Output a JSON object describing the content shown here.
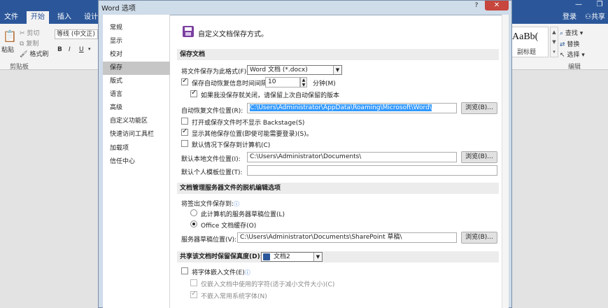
{
  "ribbon": {
    "tabs": [
      "文件",
      "开始",
      "插入",
      "设计"
    ],
    "login": "登录",
    "share": "共享",
    "paste": "粘贴",
    "cut": "剪切",
    "copy": "复制",
    "format_painter": "格式刷",
    "clipboard_label": "剪贴板",
    "font_name": "等线 (中文正)",
    "bold": "B",
    "italic": "I",
    "underline": "U",
    "styles_sample": "AaBb(",
    "styles_sample_label": "副标题",
    "find": "查找",
    "replace": "替换",
    "select": "选择",
    "editing_label": "编辑"
  },
  "dialog": {
    "title": "Word 选项",
    "help": "?",
    "close": "✕",
    "nav": [
      {
        "label": "常规"
      },
      {
        "label": "显示"
      },
      {
        "label": "校对"
      },
      {
        "label": "保存",
        "active": true
      },
      {
        "label": "版式"
      },
      {
        "label": "语言"
      },
      {
        "label": "高级"
      },
      {
        "label": "自定义功能区"
      },
      {
        "label": "快速访问工具栏"
      },
      {
        "label": "加载项"
      },
      {
        "label": "信任中心"
      }
    ],
    "header": "自定义文档保存方式。",
    "save_docs": {
      "section": "保存文档",
      "format_label": "将文件保存为此格式(F):",
      "format_value": "Word 文档 (*.docx)",
      "autorecover_label": "保存自动恢复信息时间间隔(A)",
      "autorecover_checked": true,
      "interval": "10",
      "minutes": "分钟(M)",
      "keep_last_label": "如果我没保存就关闭，请保留上次自动保留的版本",
      "keep_last_checked": true,
      "autorecover_loc_label": "自动恢复文件位置(R):",
      "autorecover_loc": "C:\\Users\\Administrator\\AppData\\Roaming\\Microsoft\\Word\\",
      "browse": "浏览(B)...",
      "no_backstage_label": "打开或保存文件时不显示 Backstage(S)",
      "no_backstage_checked": false,
      "show_other_label": "显示其他保存位置(即使可能需要登录)(S)。",
      "show_other_checked": true,
      "default_local_label": "默认情况下保存到计算机(C)",
      "default_local_checked": false,
      "default_loc_label": "默认本地文件位置(I):",
      "default_loc": "C:\\Users\\Administrator\\Documents\\",
      "browse2": "浏览(B)...",
      "template_loc_label": "默认个人模板位置(T):",
      "template_loc": ""
    },
    "offline": {
      "section": "文档管理服务器文件的脱机编辑选项",
      "save_to_label": "将签出文件保存到:",
      "info": "ⓘ",
      "opt_server": "此计算机的服务器草稿位置(L)",
      "opt_server_checked": false,
      "opt_office": "Office 文档缓存(O)",
      "opt_office_checked": true,
      "drafts_label": "服务器草稿位置(V):",
      "drafts_loc": "C:\\Users\\Administrator\\Documents\\SharePoint 草稿\\",
      "browse3": "浏览(B)..."
    },
    "fidelity": {
      "section": "共享该文档时保留保真度(D):",
      "doc_value": "文档2",
      "embed_fonts_label": "将字体嵌入文件(E)",
      "embed_fonts_checked": false,
      "info": "ⓘ",
      "only_used_label": "仅嵌入文档中使用的字符(适于减小文件大小)(C)",
      "only_used_checked": false,
      "no_common_label": "不嵌入常用系统字体(N)",
      "no_common_checked": true
    }
  }
}
